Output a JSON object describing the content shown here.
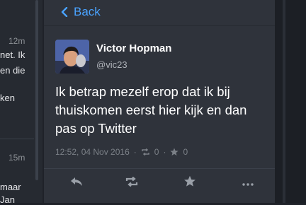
{
  "background_list": {
    "items": [
      {
        "time": "12m",
        "lines": [
          "net. Ik",
          "en die",
          "",
          "ken"
        ]
      },
      {
        "time": "15m",
        "lines": [
          "maar",
          "Jan"
        ]
      }
    ]
  },
  "topbar": {
    "back_label": "Back"
  },
  "tweet": {
    "author_name": "Victor Hopman",
    "author_handle": "@vic23",
    "text": "Ik betrap mezelf erop dat ik bij thuiskomen eerst hier kijk en dan pas op Twitter",
    "timestamp": "12:52, 04 Nov 2016",
    "retweet_count": "0",
    "favorite_count": "0"
  },
  "colors": {
    "accent": "#4aa3ff",
    "panel": "#2f333b",
    "background": "#1f2229"
  },
  "icons": {
    "back": "chevron-left-icon",
    "retweet": "retweet-icon",
    "favorite": "star-icon",
    "reply": "reply-icon",
    "more": "more-icon"
  }
}
